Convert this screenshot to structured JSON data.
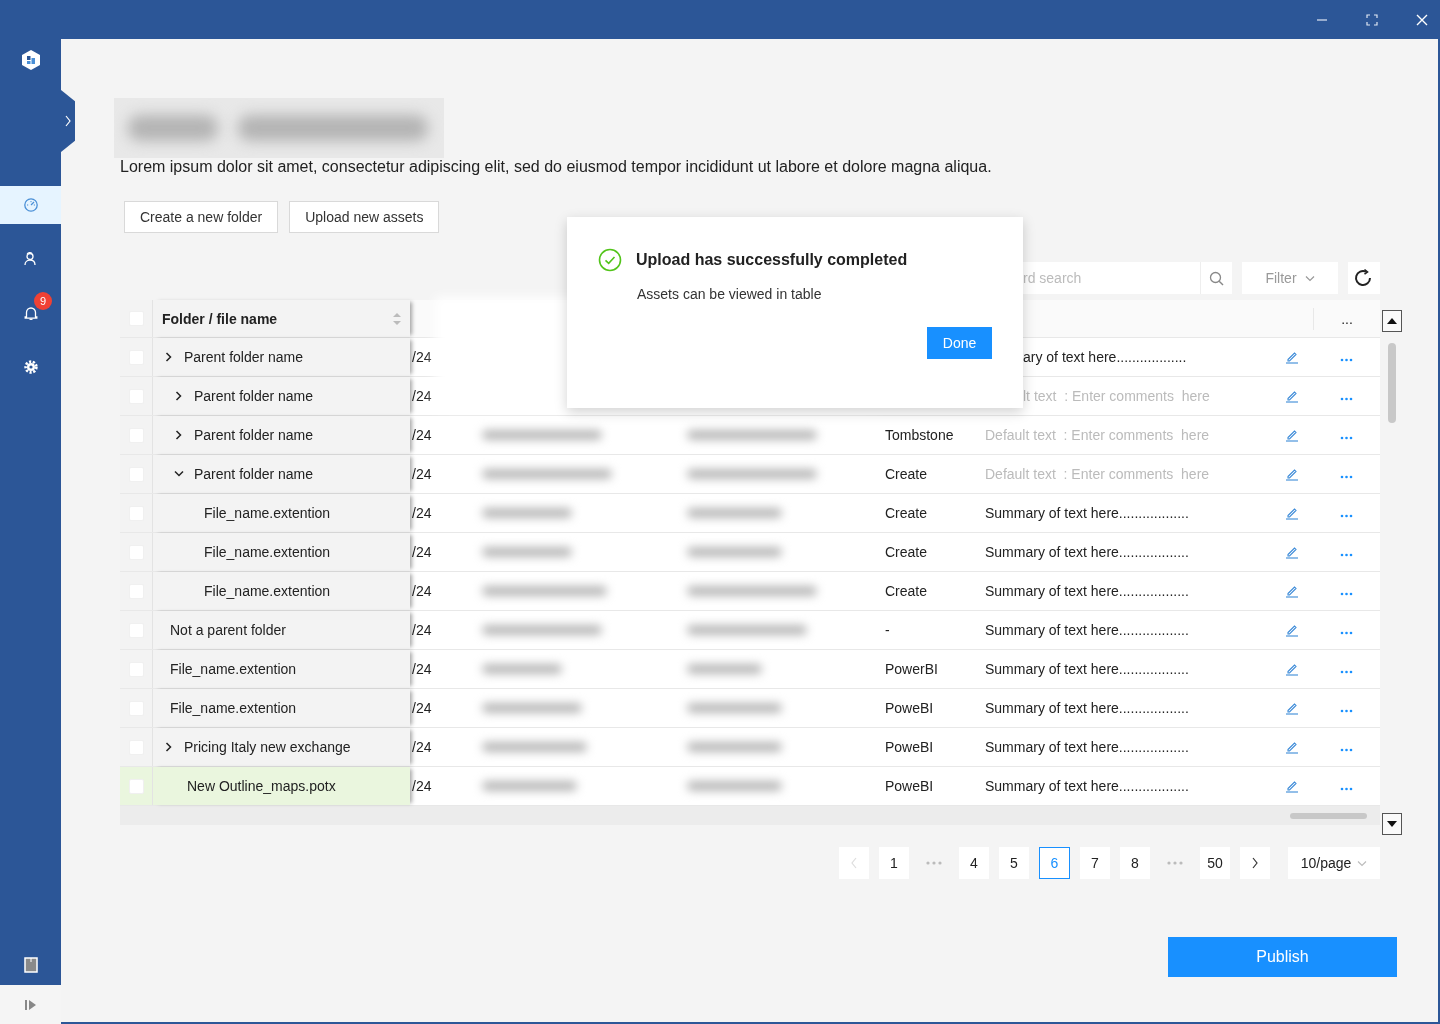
{
  "sidebar": {
    "items": [
      {
        "kind": "dashboard",
        "selected": true
      },
      {
        "kind": "users",
        "selected": false
      },
      {
        "kind": "notifications",
        "selected": false,
        "badge": "9"
      },
      {
        "kind": "settings",
        "selected": false
      }
    ]
  },
  "page": {
    "description": "Lorem ipsum dolor sit amet, consectetur adipiscing elit, sed do eiusmod tempor incididunt ut labore et dolore magna aliqua.",
    "actions": [
      "Create a new folder",
      "Upload new assets"
    ]
  },
  "toolbar": {
    "search": {
      "placeholder": "rd search"
    },
    "filter": "Filter"
  },
  "table": {
    "select_all": {
      "checked": false
    },
    "name_column": {
      "label": "Folder / file name",
      "sortable": true
    },
    "more_column": "...",
    "rows": [
      {
        "name": "Parent folder name",
        "expanded": false,
        "checked": false,
        "highlighted": false,
        "date": "/24",
        "comment": {
          "kind": "summary",
          "text": "ary of text here.................."
        },
        "children": [
          {
            "name": "Parent folder name",
            "expanded": false,
            "checked": false,
            "highlighted": false,
            "date": "/24",
            "comment": {
              "kind": "field",
              "placeholder": "lt text  : Enter comments  here"
            }
          },
          {
            "name": "Parent folder name",
            "expanded": false,
            "checked": false,
            "highlighted": false,
            "date": "/24",
            "type": "Tombstone",
            "comment": {
              "kind": "field",
              "placeholder": "Default text  : Enter comments  here"
            }
          },
          {
            "name": "Parent folder name",
            "expanded": true,
            "checked": false,
            "highlighted": false,
            "date": "/24",
            "type": "Create",
            "comment": {
              "kind": "field",
              "placeholder": "Default text  : Enter comments  here"
            },
            "children": [
              {
                "name": "File_name.extention",
                "checked": false,
                "highlighted": false,
                "date": "/24",
                "type": "Create",
                "comment": {
                  "kind": "summary",
                  "text": "Summary of text here.................."
                }
              },
              {
                "name": "File_name.extention",
                "checked": false,
                "highlighted": false,
                "date": "/24",
                "type": "Create",
                "comment": {
                  "kind": "summary",
                  "text": "Summary of text here.................."
                }
              },
              {
                "name": "File_name.extention",
                "checked": false,
                "highlighted": false,
                "date": "/24",
                "type": "Create",
                "comment": {
                  "kind": "summary",
                  "text": "Summary of text here.................."
                }
              }
            ]
          }
        ]
      },
      {
        "name": "Not a parent folder",
        "checked": false,
        "highlighted": false,
        "date": "/24",
        "type": "-",
        "comment": {
          "kind": "summary",
          "text": "Summary of text here.................."
        }
      },
      {
        "name": "File_name.extention",
        "checked": false,
        "highlighted": false,
        "date": "/24",
        "type": "PowerBI",
        "comment": {
          "kind": "summary",
          "text": "Summary of text here.................."
        }
      },
      {
        "name": "File_name.extention",
        "checked": false,
        "highlighted": false,
        "date": "/24",
        "type": "PoweBI",
        "comment": {
          "kind": "summary",
          "text": "Summary of text here.................."
        }
      },
      {
        "name": "Pricing Italy new exchange",
        "expanded": false,
        "checked": false,
        "highlighted": false,
        "date": "/24",
        "type": "PoweBI",
        "comment": {
          "kind": "summary",
          "text": "Summary of text here.................."
        },
        "children": [
          {
            "name": "New Outline_maps.potx",
            "checked": false,
            "highlighted": true,
            "date": "/24",
            "type": "PoweBI",
            "comment": {
              "kind": "summary",
              "text": "Summary of text here.................."
            }
          }
        ]
      }
    ]
  },
  "pagination": {
    "prev": {
      "disabled": true
    },
    "next": {
      "disabled": false
    },
    "pages": [
      {
        "kind": "page",
        "label": "1",
        "selected": false
      },
      {
        "kind": "ellipsis"
      },
      {
        "kind": "page",
        "label": "4",
        "selected": false
      },
      {
        "kind": "page",
        "label": "5",
        "selected": false
      },
      {
        "kind": "page",
        "label": "6",
        "selected": true
      },
      {
        "kind": "page",
        "label": "7",
        "selected": false
      },
      {
        "kind": "page",
        "label": "8",
        "selected": false
      },
      {
        "kind": "ellipsis"
      },
      {
        "kind": "page",
        "label": "50",
        "selected": false
      }
    ],
    "page_size": "10/page"
  },
  "publish": "Publish",
  "dialog": {
    "title": "Upload has successfully completed",
    "message": "Assets can be viewed in table",
    "button": "Done"
  }
}
